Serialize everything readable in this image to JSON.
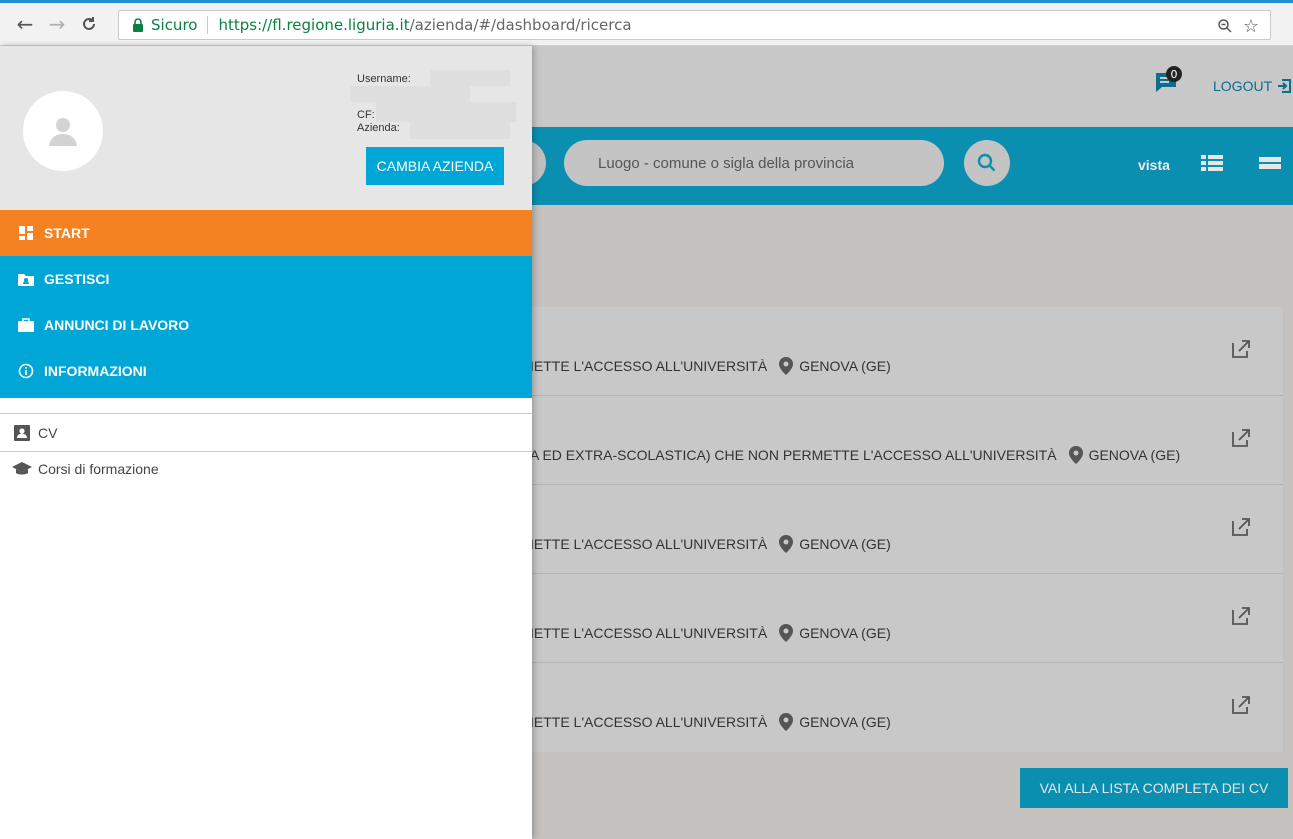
{
  "browser": {
    "secure_label": "Sicuro",
    "url_host": "https://fl.regione.liguria.it",
    "url_path": "/azienda/#/dashboard/ricerca"
  },
  "header": {
    "notifications_count": "0",
    "logout_label": "LOGOUT"
  },
  "search": {
    "luogo_placeholder": "Luogo - comune o sigla della provincia",
    "vista_label": "vista"
  },
  "cv_rows": [
    {
      "text": "IETTE L'ACCESSO ALL'UNIVERSITÀ",
      "location": "GENOVA (GE)"
    },
    {
      "text": "A ED EXTRA-SCOLASTICA) CHE NON PERMETTE L'ACCESSO ALL'UNIVERSITÀ",
      "location": "GENOVA (GE)"
    },
    {
      "text": "IETTE L'ACCESSO ALL'UNIVERSITÀ",
      "location": "GENOVA (GE)"
    },
    {
      "text": "IETTE L'ACCESSO ALL'UNIVERSITÀ",
      "location": "GENOVA (GE)"
    },
    {
      "text": "IETTE L'ACCESSO ALL'UNIVERSITÀ",
      "location": "GENOVA (GE)"
    }
  ],
  "cv_list_button": "VAI ALLA LISTA COMPLETA DEI CV",
  "drawer": {
    "username_label": "Username:",
    "cf_label": "CF:",
    "azienda_label": "Azienda:",
    "cambia_label": "CAMBIA AZIENDA",
    "menu": [
      {
        "label": "START",
        "icon": "dashboard-icon",
        "active": true
      },
      {
        "label": "GESTISCI",
        "icon": "folder-user-icon",
        "active": false
      },
      {
        "label": "ANNUNCI DI LAVORO",
        "icon": "briefcase-icon",
        "active": false
      },
      {
        "label": "INFORMAZIONI",
        "icon": "info-icon",
        "active": false
      }
    ],
    "links": [
      {
        "label": "CV",
        "icon": "contact-card-icon"
      },
      {
        "label": "Corsi di formazione",
        "icon": "graduation-cap-icon"
      }
    ]
  },
  "colors": {
    "primary": "#00a6d6",
    "active": "#f58220",
    "secure_green": "#0b8043"
  }
}
